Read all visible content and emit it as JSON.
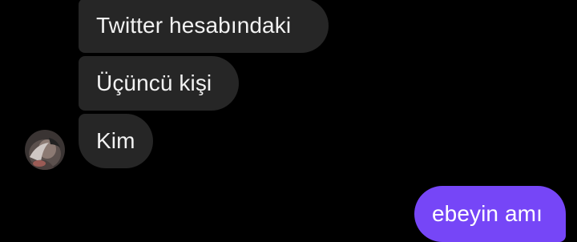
{
  "thread": {
    "incoming": [
      {
        "text": "Twitter hesabındaki"
      },
      {
        "text": "Üçüncü kişi"
      },
      {
        "text": "Kim"
      }
    ],
    "outgoing": [
      {
        "text": "ebeyin amı"
      }
    ],
    "avatar_icon": "contact-avatar-photo"
  },
  "colors": {
    "background": "#000000",
    "incoming_bubble": "#262626",
    "outgoing_bubble": "#7646f7",
    "text": "#f2f2f2"
  }
}
